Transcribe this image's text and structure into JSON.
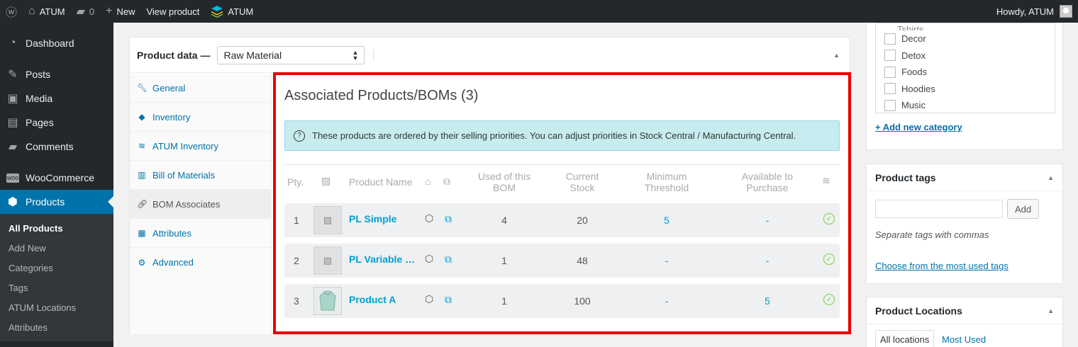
{
  "adminbar": {
    "site_name": "ATUM",
    "comments_count": "0",
    "new_label": "New",
    "view_product": "View product",
    "plugin_name": "ATUM",
    "greeting": "Howdy, ATUM"
  },
  "sidebar": {
    "dashboard": "Dashboard",
    "posts": "Posts",
    "media": "Media",
    "pages": "Pages",
    "comments": "Comments",
    "woocommerce": "WooCommerce",
    "products": "Products",
    "submenu": [
      "All Products",
      "Add New",
      "Categories",
      "Tags",
      "ATUM Locations",
      "Attributes"
    ]
  },
  "product_data": {
    "title": "Product data —",
    "type_value": "Raw Material",
    "tabs": [
      "General",
      "Inventory",
      "ATUM Inventory",
      "Bill of Materials",
      "BOM Associates",
      "Attributes",
      "Advanced"
    ]
  },
  "bom": {
    "title": "Associated Products/BOMs (3)",
    "notice": "These products are ordered by their selling priorities. You can adjust priorities in Stock Central / Manufacturing Central.",
    "headers": {
      "priority": "Pty.",
      "name": "Product Name",
      "used_1": "Used of this",
      "used_2": "BOM",
      "stock_1": "Current",
      "stock_2": "Stock",
      "min_1": "Minimum",
      "min_2": "Threshold",
      "avail_1": "Available to",
      "avail_2": "Purchase"
    },
    "rows": [
      {
        "pty": "1",
        "name": "PL Simple",
        "used": "4",
        "stock": "20",
        "min": "5",
        "avail": "-"
      },
      {
        "pty": "2",
        "name": "PL Variable Product",
        "used": "1",
        "stock": "48",
        "min": "-",
        "avail": "-"
      },
      {
        "pty": "3",
        "name": "Product A",
        "used": "1",
        "stock": "100",
        "min": "-",
        "avail": "5"
      }
    ]
  },
  "categories": {
    "partial": "Tshirts",
    "items": [
      "Decor",
      "Detox",
      "Foods",
      "Hoodies",
      "Music"
    ],
    "add_link": "+ Add new category"
  },
  "tags": {
    "title": "Product tags",
    "add_button": "Add",
    "hint": "Separate tags with commas",
    "choose_link": "Choose from the most used tags"
  },
  "locations": {
    "title": "Product Locations",
    "tab_all": "All locations",
    "tab_most": "Most Used"
  },
  "colors": {
    "highlight": "#e80000",
    "wp_blue": "#0073aa",
    "atum_blue": "#00a0d2",
    "ok_green": "#7ad03a"
  }
}
